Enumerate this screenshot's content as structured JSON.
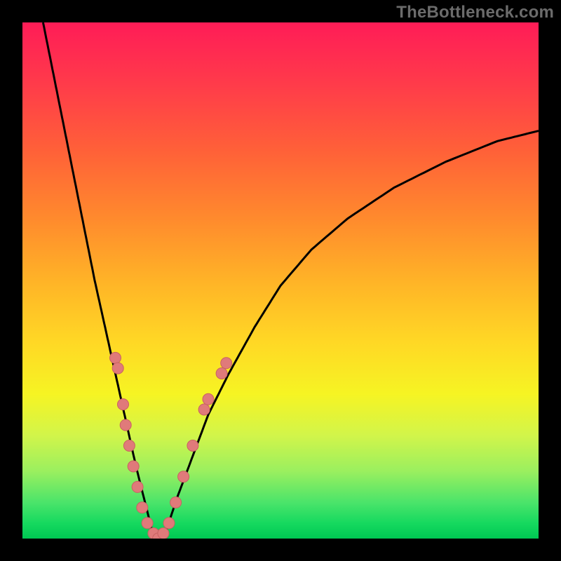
{
  "watermark_text": "TheBottleneck.com",
  "colors": {
    "curve_stroke": "#000000",
    "dot_fill": "#e07a7a",
    "dot_stroke": "#c96262"
  },
  "chart_data": {
    "type": "line",
    "title": "",
    "xlabel": "",
    "ylabel": "",
    "xlim": [
      0,
      100
    ],
    "ylim": [
      0,
      100
    ],
    "series": [
      {
        "name": "bottleneck-curve",
        "x": [
          4,
          6,
          8,
          10,
          12,
          14,
          16,
          18,
          20,
          22,
          24,
          25,
          26,
          28,
          30,
          33,
          36,
          40,
          45,
          50,
          56,
          63,
          72,
          82,
          92,
          100
        ],
        "y": [
          100,
          90,
          80,
          70,
          60,
          50,
          41,
          32,
          23,
          14,
          6,
          2,
          0,
          2,
          8,
          16,
          24,
          32,
          41,
          49,
          56,
          62,
          68,
          73,
          77,
          79
        ]
      }
    ],
    "annotations": {
      "dots": [
        {
          "x": 18,
          "y": 35
        },
        {
          "x": 18.5,
          "y": 33
        },
        {
          "x": 19.5,
          "y": 26
        },
        {
          "x": 20,
          "y": 22
        },
        {
          "x": 20.7,
          "y": 18
        },
        {
          "x": 21.5,
          "y": 14
        },
        {
          "x": 22.3,
          "y": 10
        },
        {
          "x": 23.2,
          "y": 6
        },
        {
          "x": 24.2,
          "y": 3
        },
        {
          "x": 25.4,
          "y": 1
        },
        {
          "x": 26.3,
          "y": 0
        },
        {
          "x": 27.3,
          "y": 1
        },
        {
          "x": 28.4,
          "y": 3
        },
        {
          "x": 29.7,
          "y": 7
        },
        {
          "x": 31.2,
          "y": 12
        },
        {
          "x": 33.0,
          "y": 18
        },
        {
          "x": 35.2,
          "y": 25
        },
        {
          "x": 36.0,
          "y": 27
        },
        {
          "x": 38.6,
          "y": 32
        },
        {
          "x": 39.5,
          "y": 34
        }
      ],
      "dot_radius": 8
    }
  }
}
